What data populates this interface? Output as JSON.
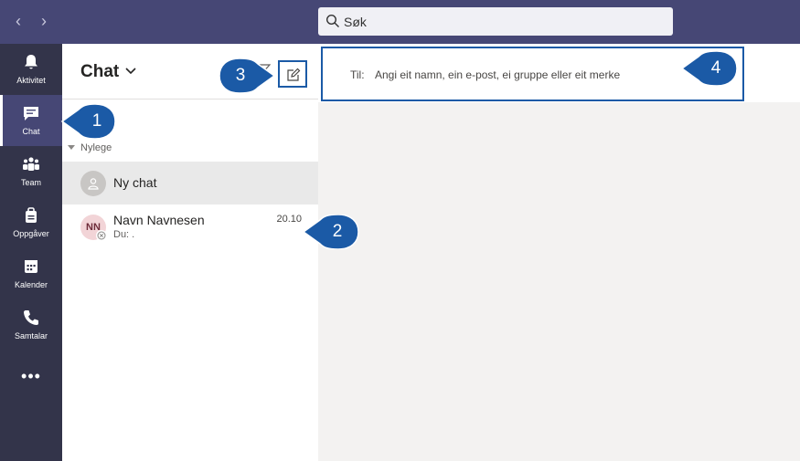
{
  "search": {
    "placeholder": "Søk"
  },
  "rail": {
    "items": [
      {
        "label": "Aktivitet",
        "icon": "bell-icon"
      },
      {
        "label": "Chat",
        "icon": "chat-icon",
        "active": true
      },
      {
        "label": "Team",
        "icon": "team-icon"
      },
      {
        "label": "Oppgåver",
        "icon": "assignments-icon"
      },
      {
        "label": "Kalender",
        "icon": "calendar-icon"
      },
      {
        "label": "Samtalar",
        "icon": "phone-icon"
      }
    ],
    "more": "•••"
  },
  "chatlist": {
    "title": "Chat",
    "section": "Nylege",
    "rows": [
      {
        "name": "Ny chat",
        "avatar_initials": "",
        "subtitle": "",
        "time": ""
      },
      {
        "name": "Navn Navnesen",
        "avatar_initials": "NN",
        "subtitle": "Du: .",
        "time": "20.10"
      }
    ]
  },
  "compose_to": {
    "label": "Til:",
    "placeholder": "Angi eit namn, ein e-post, ei gruppe eller eit merke"
  },
  "callouts": [
    "1",
    "2",
    "3",
    "4"
  ],
  "colors": {
    "topbar": "#464775",
    "rail": "#33344a",
    "callout": "#1b5aa6",
    "highlight_border": "#1b5aa6"
  }
}
